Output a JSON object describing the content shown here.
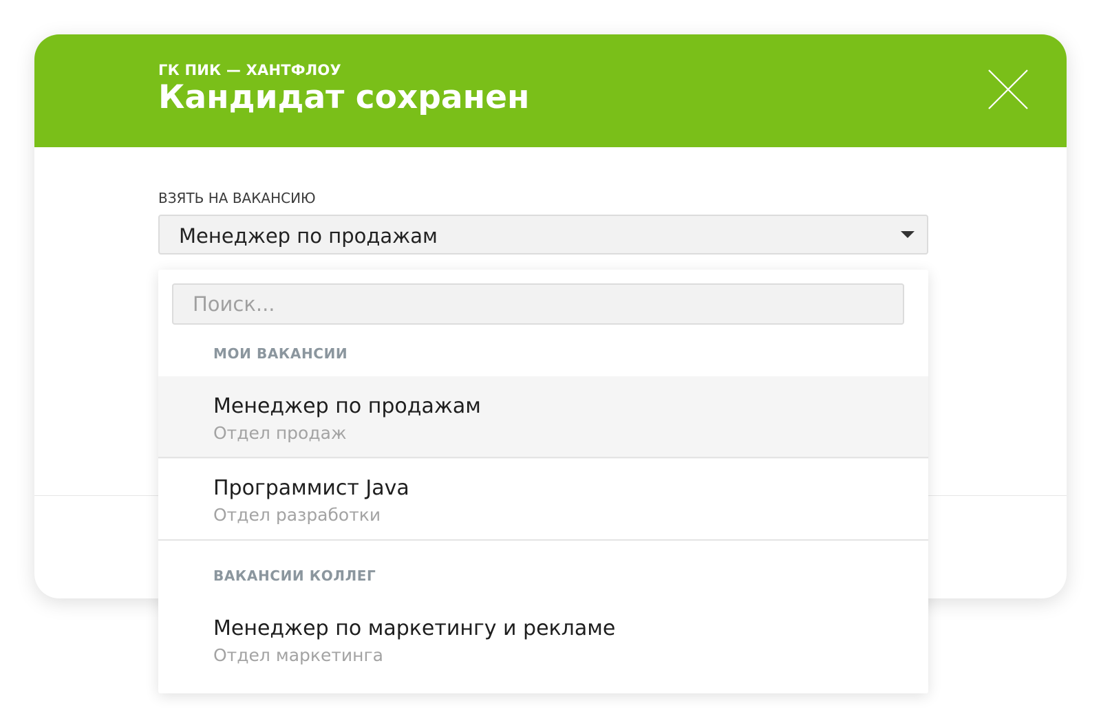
{
  "modal": {
    "subtitle": "ГК ПИК — ХАНТФЛОУ",
    "title": "Кандидат сохранен",
    "accent_color": "#7abf19",
    "close_icon": "close-icon"
  },
  "vacancy_field": {
    "label": "ВЗЯТЬ НА ВАКАНСИЮ",
    "selected_value": "Менеджер по продажам",
    "caret_icon": "chevron-down-icon"
  },
  "dropdown": {
    "search_placeholder": "Поиск...",
    "groups": [
      {
        "header": "МОИ ВАКАНСИИ",
        "items": [
          {
            "title": "Менеджер по продажам",
            "department": "Отдел продаж",
            "selected": true
          },
          {
            "title": "Программист Java",
            "department": "Отдел разработки",
            "selected": false
          }
        ]
      },
      {
        "header": "ВАКАНСИИ КОЛЛЕГ",
        "items": [
          {
            "title": "Менеджер по маркетингу и рекламе",
            "department": "Отдел маркетинга",
            "selected": false
          }
        ]
      }
    ]
  }
}
